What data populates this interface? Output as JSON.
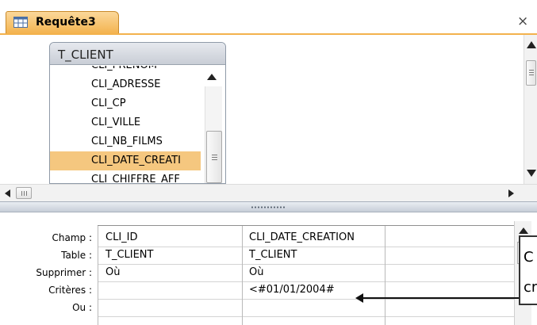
{
  "tab": {
    "title": "Requête3",
    "close": "×"
  },
  "table": {
    "name": "T_CLIENT",
    "fields": [
      "CLI_PRENOM",
      "CLI_ADRESSE",
      "CLI_CP",
      "CLI_VILLE",
      "CLI_NB_FILMS",
      "CLI_DATE_CREATI",
      "CLI_CHIFFRE_AFF"
    ],
    "selected_field": "CLI_DATE_CREATI"
  },
  "grid": {
    "row_labels": [
      "Champ :",
      "Table :",
      "Supprimer :",
      "Critères :",
      "Ou :"
    ],
    "columns": [
      {
        "champ": "CLI_ID",
        "table": "T_CLIENT",
        "supprimer": "Où",
        "criteres": ""
      },
      {
        "champ": "CLI_DATE_CREATION",
        "table": "T_CLIENT",
        "supprimer": "Où",
        "criteres": "<#01/01/2004#"
      },
      {
        "champ": "",
        "table": "",
        "supprimer": "",
        "criteres": ""
      }
    ]
  },
  "callout": {
    "line1": "C",
    "line2": "cr"
  },
  "colors": {
    "tab_accent": "#f3b24d",
    "selected_row": "#f5c77f"
  }
}
